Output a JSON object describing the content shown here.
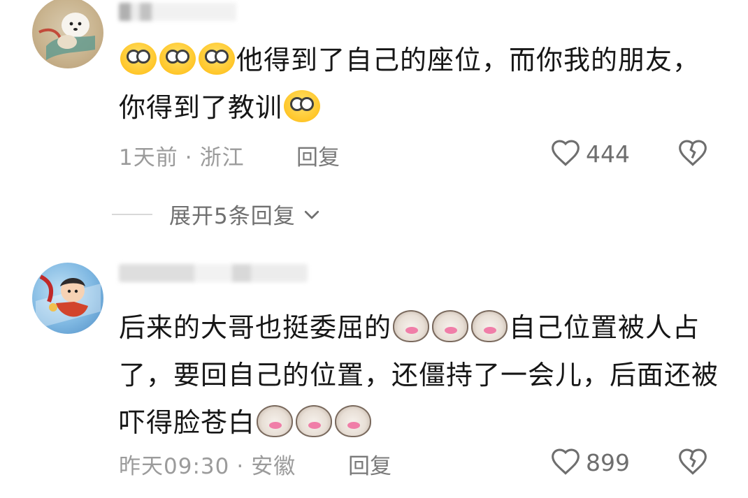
{
  "comments": [
    {
      "text_part1": "他得到了自己的座位，而你我的朋友，你得到了教训",
      "time": "1天前",
      "location": "浙江",
      "reply_label": "回复",
      "likes": "444",
      "expand_label": "展开5条回复"
    },
    {
      "text_part1": "后来的大哥也挺委屈的",
      "text_part2": "自己位置被人占了，要回自己的位置，还僵持了一会儿，后面还被吓得脸苍白",
      "time": "昨天09:30",
      "location": "安徽",
      "reply_label": "回复",
      "likes": "899"
    }
  ],
  "meta_separator": "·",
  "icons": {
    "like": "heart-outline-icon",
    "dislike": "broken-heart-icon",
    "expand": "chevron-down-icon",
    "emoji1": "crying-laughing-emoji",
    "emoji2": "cat-face-emoji"
  },
  "colors": {
    "text": "#161616",
    "meta": "#9b9b9b",
    "icon": "#6e6e6e"
  }
}
